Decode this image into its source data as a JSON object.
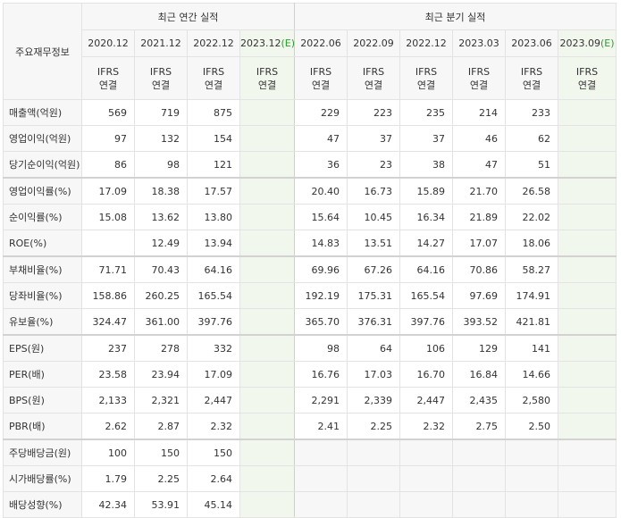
{
  "headers": {
    "label": "주요재무정보",
    "annual_group": "최근 연간 실적",
    "quarter_group": "최근 분기 실적",
    "annual_periods": [
      "2020.12",
      "2021.12",
      "2022.12",
      "2023.12"
    ],
    "annual_estimate_mark": "(E)",
    "quarter_periods": [
      "2022.06",
      "2022.09",
      "2022.12",
      "2023.03",
      "2023.06",
      "2023.09"
    ],
    "quarter_estimate_mark": "(E)",
    "ifrs_top": "IFRS",
    "ifrs_bottom": "연결"
  },
  "rows": [
    {
      "label": "매출액(억원)",
      "annual": [
        "569",
        "719",
        "875",
        ""
      ],
      "quarter": [
        "229",
        "223",
        "235",
        "214",
        "233",
        ""
      ]
    },
    {
      "label": "영업이익(억원)",
      "annual": [
        "97",
        "132",
        "154",
        ""
      ],
      "quarter": [
        "47",
        "37",
        "37",
        "46",
        "62",
        ""
      ]
    },
    {
      "label": "당기순이익(억원)",
      "annual": [
        "86",
        "98",
        "121",
        ""
      ],
      "quarter": [
        "36",
        "23",
        "38",
        "47",
        "51",
        ""
      ]
    },
    {
      "label": "영업이익률(%)",
      "annual": [
        "17.09",
        "18.38",
        "17.57",
        ""
      ],
      "quarter": [
        "20.40",
        "16.73",
        "15.89",
        "21.70",
        "26.58",
        ""
      ]
    },
    {
      "label": "순이익률(%)",
      "annual": [
        "15.08",
        "13.62",
        "13.80",
        ""
      ],
      "quarter": [
        "15.64",
        "10.45",
        "16.34",
        "21.89",
        "22.02",
        ""
      ]
    },
    {
      "label": "ROE(%)",
      "annual": [
        "",
        "12.49",
        "13.94",
        ""
      ],
      "quarter": [
        "14.83",
        "13.51",
        "14.27",
        "17.07",
        "18.06",
        ""
      ]
    },
    {
      "label": "부채비율(%)",
      "annual": [
        "71.71",
        "70.43",
        "64.16",
        ""
      ],
      "quarter": [
        "69.96",
        "67.26",
        "64.16",
        "70.86",
        "58.27",
        ""
      ]
    },
    {
      "label": "당좌비율(%)",
      "annual": [
        "158.86",
        "260.25",
        "165.54",
        ""
      ],
      "quarter": [
        "192.19",
        "175.31",
        "165.54",
        "97.69",
        "174.91",
        ""
      ]
    },
    {
      "label": "유보율(%)",
      "annual": [
        "324.47",
        "361.00",
        "397.76",
        ""
      ],
      "quarter": [
        "365.70",
        "376.31",
        "397.76",
        "393.52",
        "421.81",
        ""
      ]
    },
    {
      "label": "EPS(원)",
      "annual": [
        "237",
        "278",
        "332",
        ""
      ],
      "quarter": [
        "98",
        "64",
        "106",
        "129",
        "141",
        ""
      ]
    },
    {
      "label": "PER(배)",
      "annual": [
        "23.58",
        "23.94",
        "17.09",
        ""
      ],
      "quarter": [
        "16.76",
        "17.03",
        "16.70",
        "16.84",
        "14.66",
        ""
      ]
    },
    {
      "label": "BPS(원)",
      "annual": [
        "2,133",
        "2,321",
        "2,447",
        ""
      ],
      "quarter": [
        "2,291",
        "2,339",
        "2,447",
        "2,435",
        "2,580",
        ""
      ]
    },
    {
      "label": "PBR(배)",
      "annual": [
        "2.62",
        "2.87",
        "2.32",
        ""
      ],
      "quarter": [
        "2.41",
        "2.25",
        "2.32",
        "2.75",
        "2.50",
        ""
      ]
    },
    {
      "label": "주당배당금(원)",
      "annual": [
        "100",
        "150",
        "150",
        ""
      ],
      "quarter": [
        "",
        "",
        "",
        "",
        "",
        ""
      ]
    },
    {
      "label": "시가배당률(%)",
      "annual": [
        "1.79",
        "2.25",
        "2.64",
        ""
      ],
      "quarter": [
        "",
        "",
        "",
        "",
        "",
        ""
      ]
    },
    {
      "label": "배당성향(%)",
      "annual": [
        "42.34",
        "53.91",
        "45.14",
        ""
      ],
      "quarter": [
        "",
        "",
        "",
        "",
        "",
        ""
      ]
    }
  ],
  "colors": {
    "ifrs_text": "#e8700f",
    "estimate_mark": "#2e9a2e",
    "estimate_column_bg": "#f2f7ee",
    "header_bg": "#f7f7f7",
    "border": "#e3e3e3"
  }
}
